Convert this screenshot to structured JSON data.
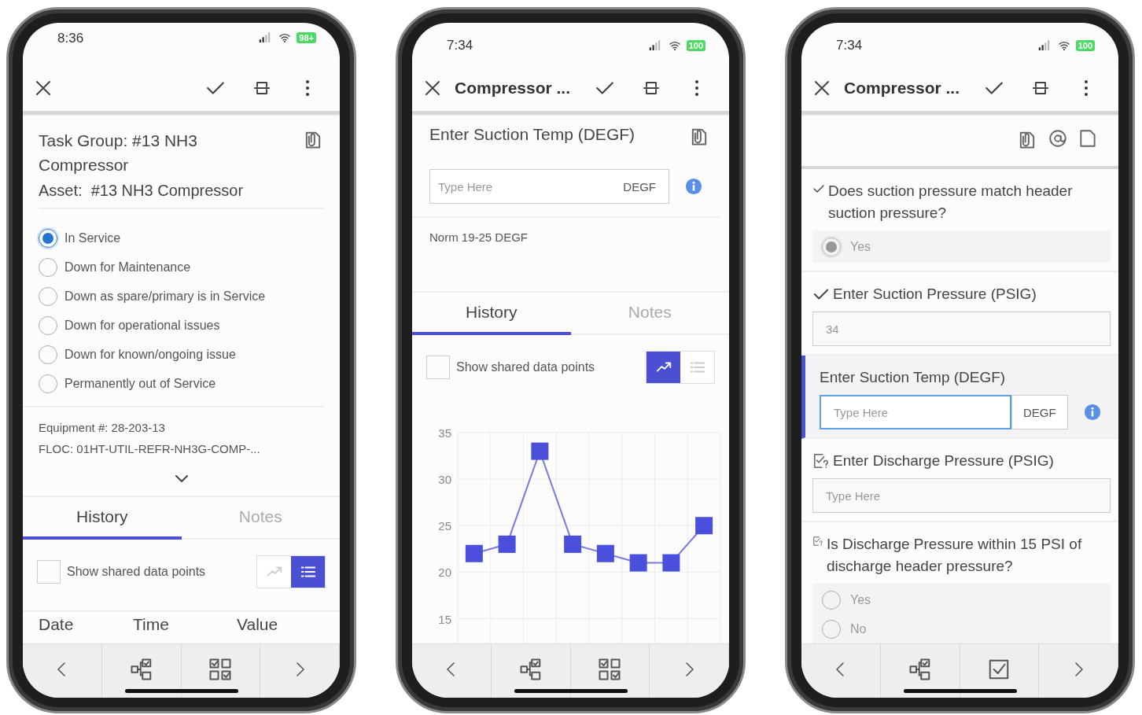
{
  "phones": [
    {
      "kind": "task_group",
      "status_bar": {
        "time": "8:36",
        "battery": "98+"
      },
      "task_group": "Task Group: #13 NH3 Compressor",
      "asset": "Asset:  #13 NH3 Compressor",
      "status_options": [
        {
          "label": "In Service",
          "selected": true
        },
        {
          "label": "Down for Maintenance",
          "selected": false
        },
        {
          "label": "Down as spare/primary is in Service",
          "selected": false
        },
        {
          "label": "Down for operational issues",
          "selected": false
        },
        {
          "label": "Down for known/ongoing issue",
          "selected": false
        },
        {
          "label": "Permanently out of Service",
          "selected": false
        }
      ],
      "equipment": "Equipment #: 28-203-13",
      "floc": "FLOC: 01HT-UTIL-REFR-NH3G-COMP-...",
      "tabs": [
        {
          "label": "History",
          "selected": true
        },
        {
          "label": "Notes",
          "selected": false
        }
      ],
      "shared_points": {
        "label": "Show shared data points",
        "checked": false
      },
      "view_toggle": [
        {
          "selected": false
        },
        {
          "selected": true
        }
      ],
      "table": {
        "columns": [
          "Date",
          "Time",
          "Value"
        ]
      }
    },
    {
      "kind": "reading",
      "status_bar": {
        "time": "7:34",
        "battery": "100"
      },
      "toolbar": {
        "title": "Compressor ..."
      },
      "question": "Enter Suction Temp (DEGF)",
      "input": {
        "placeholder": "Type Here",
        "unit": "DEGF"
      },
      "norm": "Norm 19-25 DEGF",
      "tabs": [
        {
          "label": "History",
          "selected": true
        },
        {
          "label": "Notes",
          "selected": false
        }
      ],
      "shared_points": {
        "label": "Show shared data points",
        "checked": false
      },
      "view_toggle": [
        {
          "selected": true
        },
        {
          "selected": false
        }
      ],
      "chart_data": {
        "type": "line",
        "grid": true,
        "ylim": [
          12,
          35
        ],
        "yticks": [
          15,
          20,
          25,
          30,
          35
        ],
        "series": [
          {
            "color": "#4a4fdc",
            "marker": "square",
            "values": [
              22,
              23,
              33,
              23,
              22,
              21,
              21,
              25
            ]
          }
        ]
      }
    },
    {
      "kind": "checklist",
      "status_bar": {
        "time": "7:34",
        "battery": "100"
      },
      "toolbar": {
        "title": "Compressor ..."
      },
      "items": [
        {
          "kind": "choice",
          "answered": true,
          "active": false,
          "question": "Does suction pressure match header suction pressure?",
          "options": [
            {
              "label": "Yes",
              "selected": true
            }
          ]
        },
        {
          "kind": "number",
          "answered": true,
          "active": false,
          "question": "Enter Suction Pressure (PSIG)",
          "value": "34"
        },
        {
          "kind": "number",
          "answered": false,
          "active": true,
          "question": "Enter Suction Temp (DEGF)",
          "placeholder": "Type Here",
          "unit": "DEGF"
        },
        {
          "kind": "number",
          "answered": false,
          "active": false,
          "question": "Enter Discharge Pressure (PSIG)",
          "placeholder": "Type Here"
        },
        {
          "kind": "choice",
          "answered": false,
          "active": false,
          "question": "Is Discharge Pressure within 15 PSI of discharge header pressure?",
          "options": [
            {
              "label": "Yes",
              "selected": false
            },
            {
              "label": "No",
              "selected": false
            }
          ]
        }
      ]
    }
  ]
}
